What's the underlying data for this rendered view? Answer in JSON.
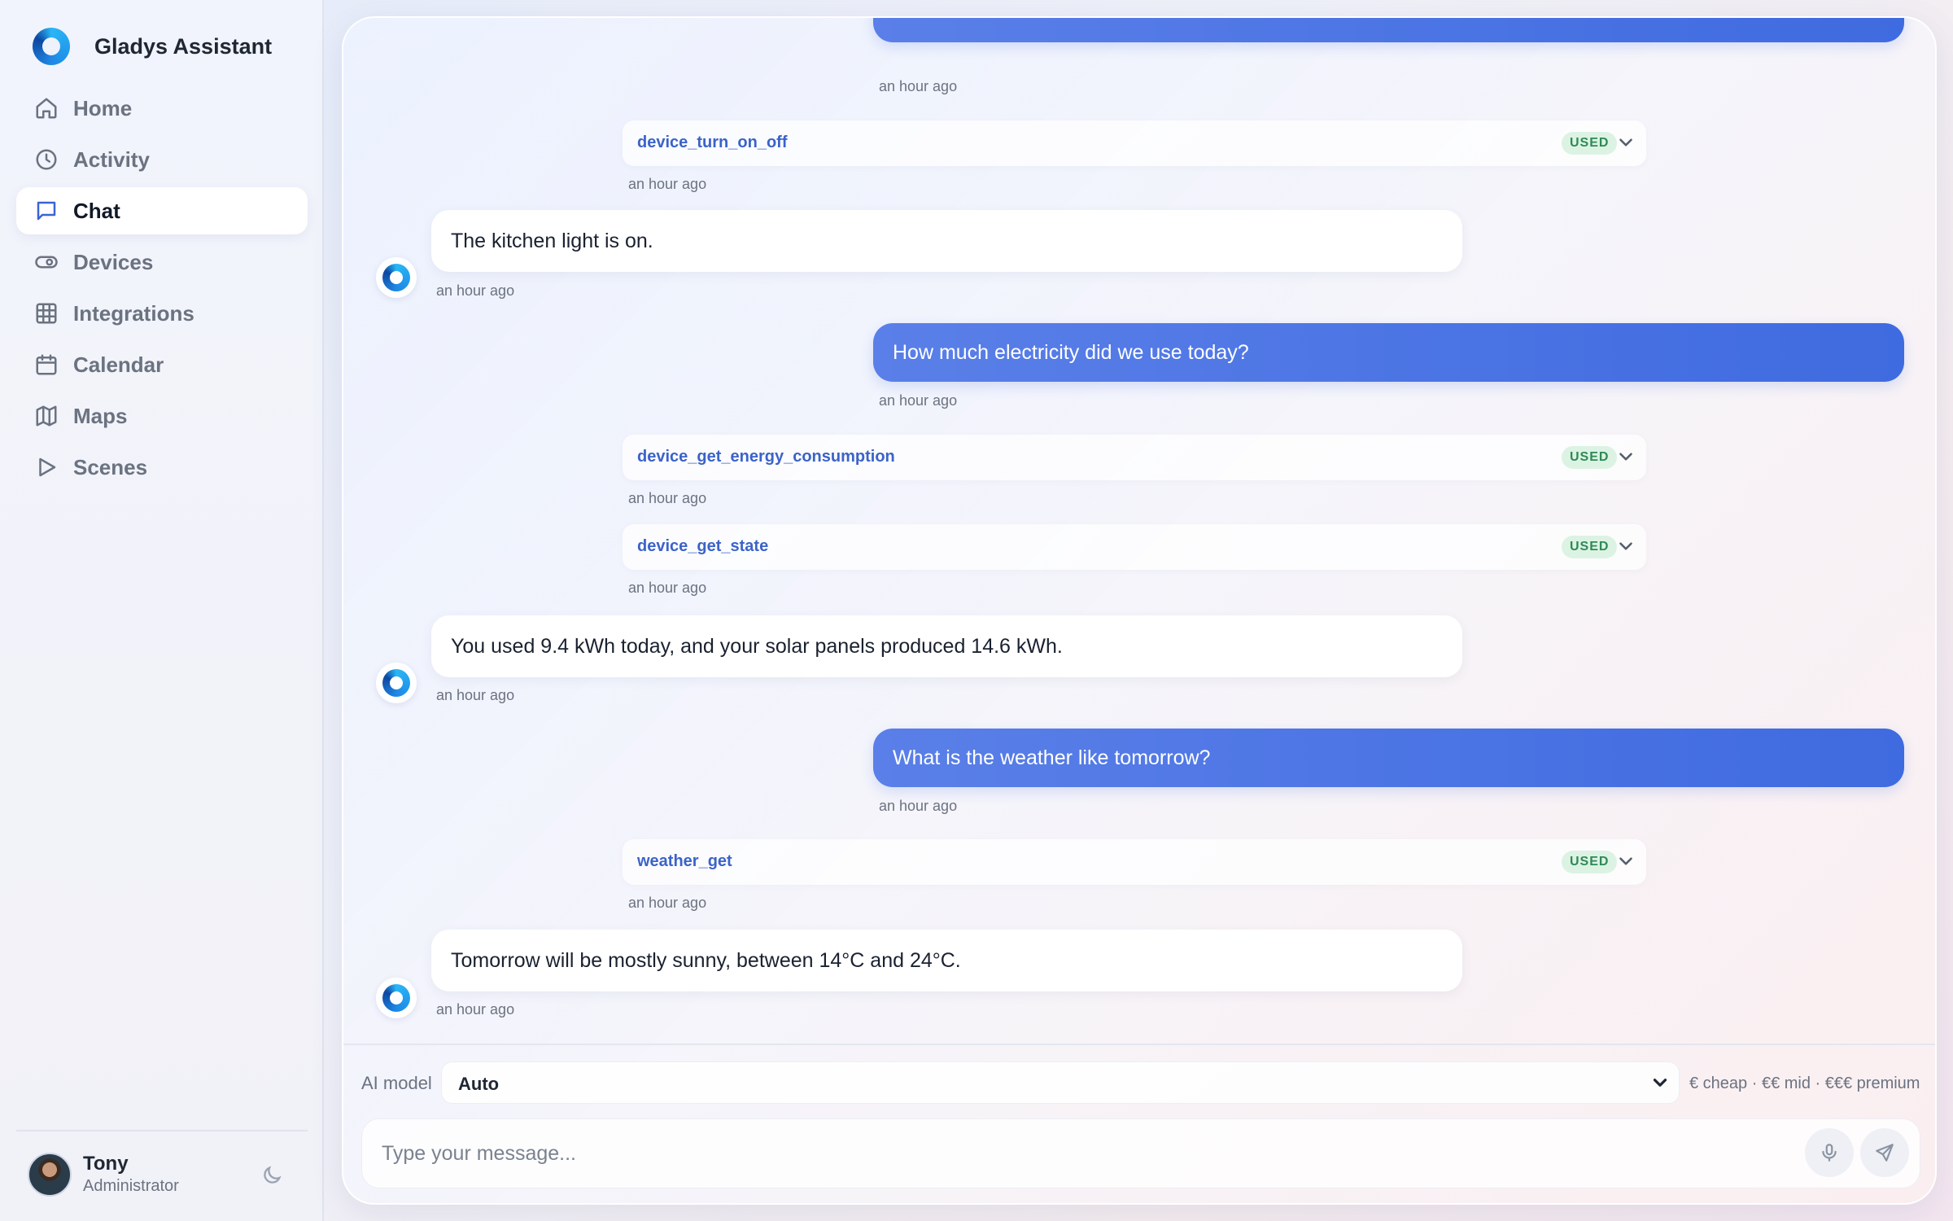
{
  "app": {
    "name": "Gladys Assistant"
  },
  "nav": {
    "items": [
      {
        "label": "Home",
        "icon": "home-icon"
      },
      {
        "label": "Activity",
        "icon": "clock-icon"
      },
      {
        "label": "Chat",
        "icon": "message-icon",
        "active": true
      },
      {
        "label": "Devices",
        "icon": "toggle-icon"
      },
      {
        "label": "Integrations",
        "icon": "grid-icon"
      },
      {
        "label": "Calendar",
        "icon": "calendar-icon"
      },
      {
        "label": "Maps",
        "icon": "map-icon"
      },
      {
        "label": "Scenes",
        "icon": "play-icon"
      }
    ]
  },
  "user": {
    "name": "Tony",
    "role": "Administrator"
  },
  "chat": {
    "top_timestamp": "an hour ago",
    "tool1": {
      "name": "device_turn_on_off",
      "badge": "USED",
      "time": "an hour ago"
    },
    "ai1": {
      "text": "The kitchen light is on.",
      "time": "an hour ago"
    },
    "user2": {
      "text": "How much electricity did we use today?",
      "time": "an hour ago"
    },
    "tool2": {
      "name": "device_get_energy_consumption",
      "badge": "USED",
      "time": "an hour ago"
    },
    "tool3": {
      "name": "device_get_state",
      "badge": "USED",
      "time": "an hour ago"
    },
    "ai2": {
      "text": "You used 9.4 kWh today, and your solar panels produced 14.6 kWh.",
      "time": "an hour ago"
    },
    "user3": {
      "text": "What is the weather like tomorrow?",
      "time": "an hour ago"
    },
    "tool4": {
      "name": "weather_get",
      "badge": "USED",
      "time": "an hour ago"
    },
    "ai3": {
      "text": "Tomorrow will be mostly sunny, between 14°C and 24°C.",
      "time": "an hour ago"
    }
  },
  "composer": {
    "model_label": "AI model",
    "model_value": "Auto",
    "model_hint": "€ cheap · €€ mid · €€€ premium",
    "placeholder": "Type your message..."
  },
  "colors": {
    "accent": "#4a74e6",
    "badge_bg": "#dcf3e4",
    "badge_text": "#2e8a55"
  }
}
